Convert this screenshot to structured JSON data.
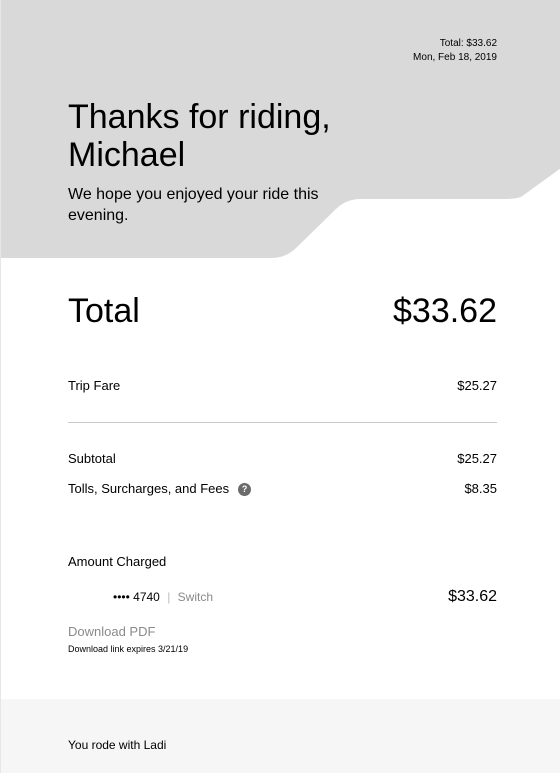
{
  "header": {
    "total_line": "Total: $33.62",
    "date": "Mon, Feb 18, 2019",
    "greeting_line1": "Thanks for riding,",
    "greeting_line2": "Michael",
    "subtitle": "We hope you enjoyed your ride this evening.",
    "bg_color": "#d9d9d9"
  },
  "summary": {
    "total_label": "Total",
    "total_value": "$33.62"
  },
  "fare": {
    "trip_fare_label": "Trip Fare",
    "trip_fare_value": "$25.27",
    "subtotal_label": "Subtotal",
    "subtotal_value": "$25.27",
    "fees_label": "Tolls, Surcharges, and Fees",
    "fees_value": "$8.35",
    "help_icon": "question-circle-icon"
  },
  "payment": {
    "amount_charged_label": "Amount Charged",
    "card_dots": "••••",
    "card_last4": "4740",
    "separator": "|",
    "switch_label": "Switch",
    "charged_value": "$33.62"
  },
  "download": {
    "pdf_label": "Download PDF",
    "expires_text": "Download link expires 3/21/19"
  },
  "footer": {
    "rode_with": "You rode with Ladi"
  }
}
